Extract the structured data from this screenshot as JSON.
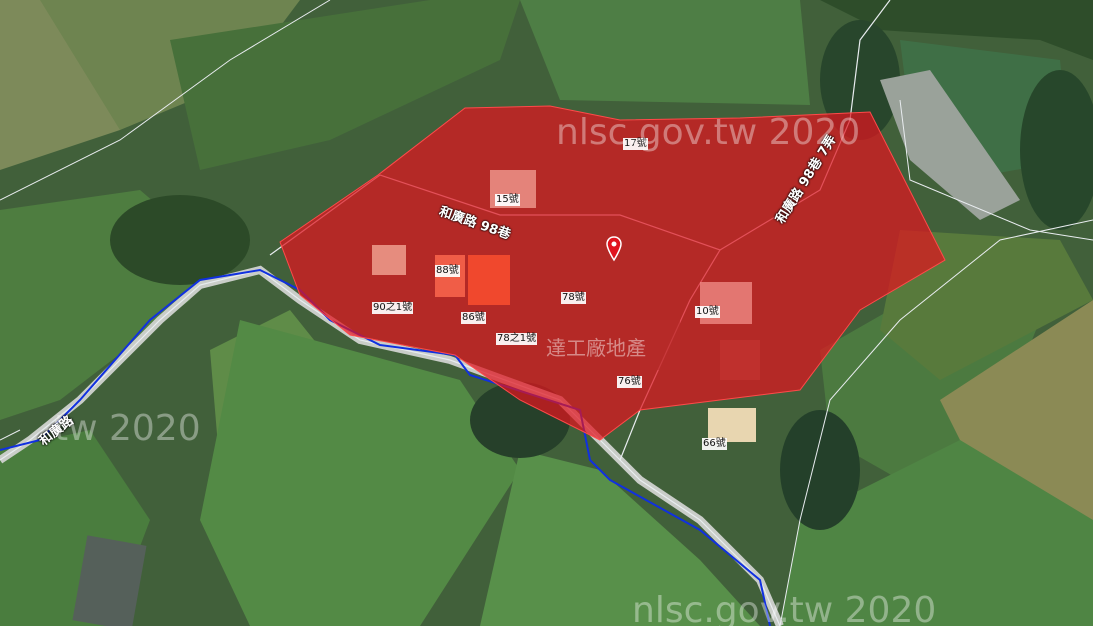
{
  "map": {
    "road_labels": {
      "heguang_road": "和廣路",
      "lane98": "和廣路 98巷",
      "lane98_alley7": "和廣路 98巷 7弄"
    },
    "address_labels": [
      {
        "id": "no17",
        "text": "17號"
      },
      {
        "id": "no15",
        "text": "15號"
      },
      {
        "id": "no88",
        "text": "88號"
      },
      {
        "id": "no90-1",
        "text": "90之1號"
      },
      {
        "id": "no86",
        "text": "86號"
      },
      {
        "id": "no78-1",
        "text": "78之1號"
      },
      {
        "id": "no78",
        "text": "78號"
      },
      {
        "id": "no10",
        "text": "10號"
      },
      {
        "id": "no76",
        "text": "76號"
      },
      {
        "id": "no66",
        "text": "66號"
      }
    ],
    "watermarks": [
      "nlsc.gov.tw 2020",
      "tw 2020",
      "nlsc.gov.tw 2020"
    ],
    "brand_watermark": "達工廠地產",
    "colors": {
      "highlight_fill": "#e0141e",
      "stream": "#1030e0",
      "road": "#e8ecef",
      "field_green": "#4a7a3a"
    },
    "icons": [
      "location-pin-icon"
    ]
  }
}
